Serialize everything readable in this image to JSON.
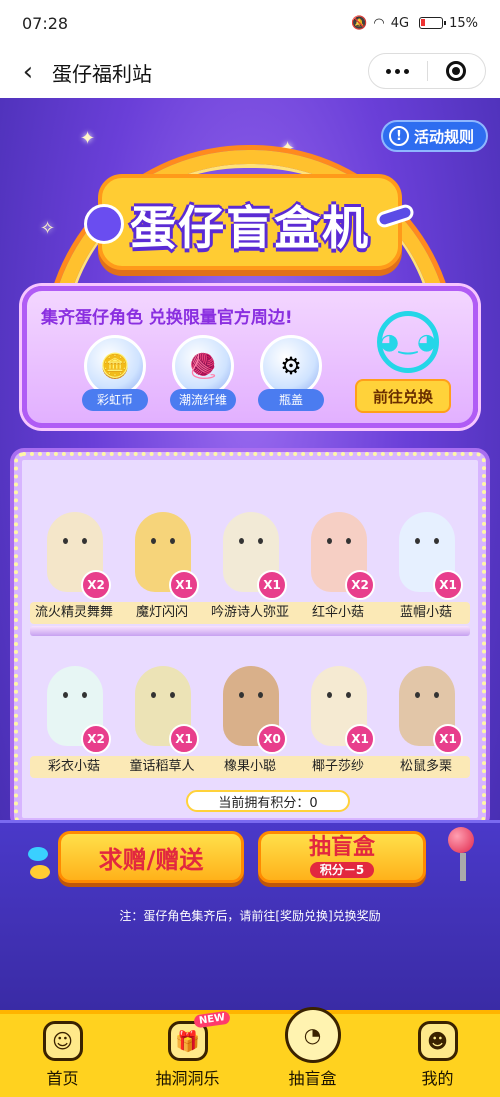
{
  "status": {
    "time": "07:28",
    "battery": "15%",
    "network": "4G"
  },
  "nav": {
    "title": "蛋仔福利站"
  },
  "rules_label": "活动规则",
  "banner_title": "蛋仔盲盒机",
  "panel": {
    "hint": "集齐蛋仔角色 兑换限量官方周边!",
    "items": [
      {
        "label": "彩虹币"
      },
      {
        "label": "潮流纤维"
      },
      {
        "label": "瓶盖"
      }
    ],
    "exchange_label": "前往兑换"
  },
  "shelves": [
    {
      "figures": [
        {
          "name": "流火精灵舞舞",
          "count": "X2",
          "color": "#f4e6c9"
        },
        {
          "name": "魔灯闪闪",
          "count": "X1",
          "color": "#f6d47a"
        },
        {
          "name": "吟游诗人弥亚",
          "count": "X1",
          "color": "#f2ead6"
        },
        {
          "name": "红伞小菇",
          "count": "X2",
          "color": "#f6cfc4"
        },
        {
          "name": "蓝帽小菇",
          "count": "X1",
          "color": "#e6f0ff"
        }
      ]
    },
    {
      "figures": [
        {
          "name": "彩衣小菇",
          "count": "X2",
          "color": "#e7f6f4"
        },
        {
          "name": "童话稻草人",
          "count": "X1",
          "color": "#ece3b6"
        },
        {
          "name": "橡果小聪",
          "count": "X0",
          "color": "#d9b08a"
        },
        {
          "name": "椰子莎纱",
          "count": "X1",
          "color": "#f5ead2"
        },
        {
          "name": "松鼠多栗",
          "count": "X1",
          "color": "#e2c6a8"
        }
      ]
    }
  ],
  "points_text": "当前拥有积分：0",
  "gift_button": "求赠/赠送",
  "draw_button": {
    "title": "抽盲盒",
    "cost": "积分－5"
  },
  "note": "注：蛋仔角色集齐后，请前往[奖励兑换]兑换奖励",
  "tabs": [
    {
      "label": "首页",
      "badge": ""
    },
    {
      "label": "抽洞洞乐",
      "badge": "NEW"
    },
    {
      "label": "抽盲盒",
      "badge": ""
    },
    {
      "label": "我的",
      "badge": ""
    }
  ]
}
